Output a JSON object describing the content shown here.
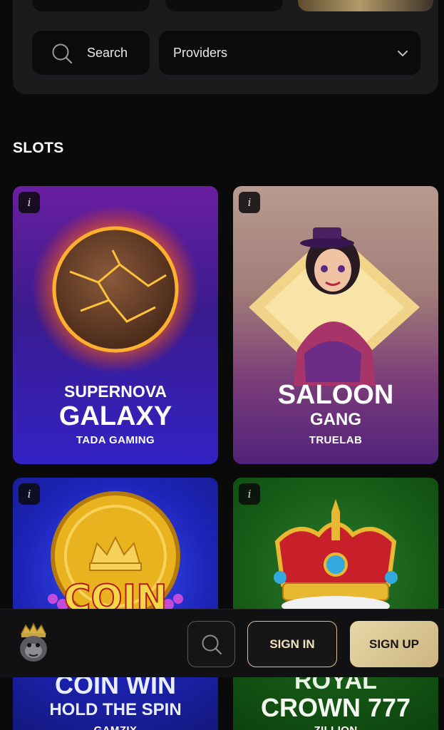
{
  "filters": {
    "search_label": "Search",
    "providers_label": "Providers"
  },
  "section": {
    "title": "SLOTS"
  },
  "games": [
    {
      "title_top": "SUPERNOVA",
      "title_main": "GALAXY",
      "provider": "TADA GAMING",
      "info": "i"
    },
    {
      "title_top": "SALOON",
      "title_main": "GANG",
      "provider": "TRUELAB",
      "info": "i"
    },
    {
      "title_top": "COIN WIN",
      "title_main": "HOLD THE SPIN",
      "provider": "GAMZIX",
      "info": "i",
      "art_text": "COIN"
    },
    {
      "title_top": "ROYAL",
      "title_main": "CROWN 777",
      "provider": "ZILLION",
      "info": "i"
    }
  ],
  "bottom_bar": {
    "sign_in": "SIGN IN",
    "sign_up": "SIGN UP"
  },
  "colors": {
    "accent_gold": "#d9c48f",
    "panel": "#1b1b1e",
    "background": "#0a0a0b"
  },
  "icons": [
    "search-icon",
    "chevron-down-icon",
    "info-icon",
    "gorilla-king-logo"
  ]
}
